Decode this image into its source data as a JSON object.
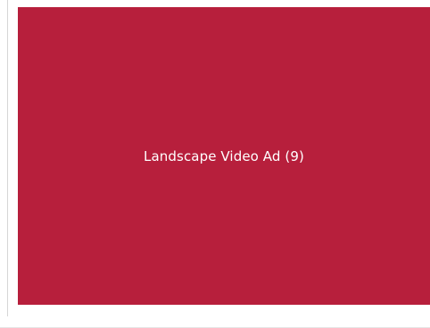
{
  "ad": {
    "label": "Landscape Video Ad (9)",
    "background_color": "#b71f3c",
    "text_color": "#ffffff"
  }
}
